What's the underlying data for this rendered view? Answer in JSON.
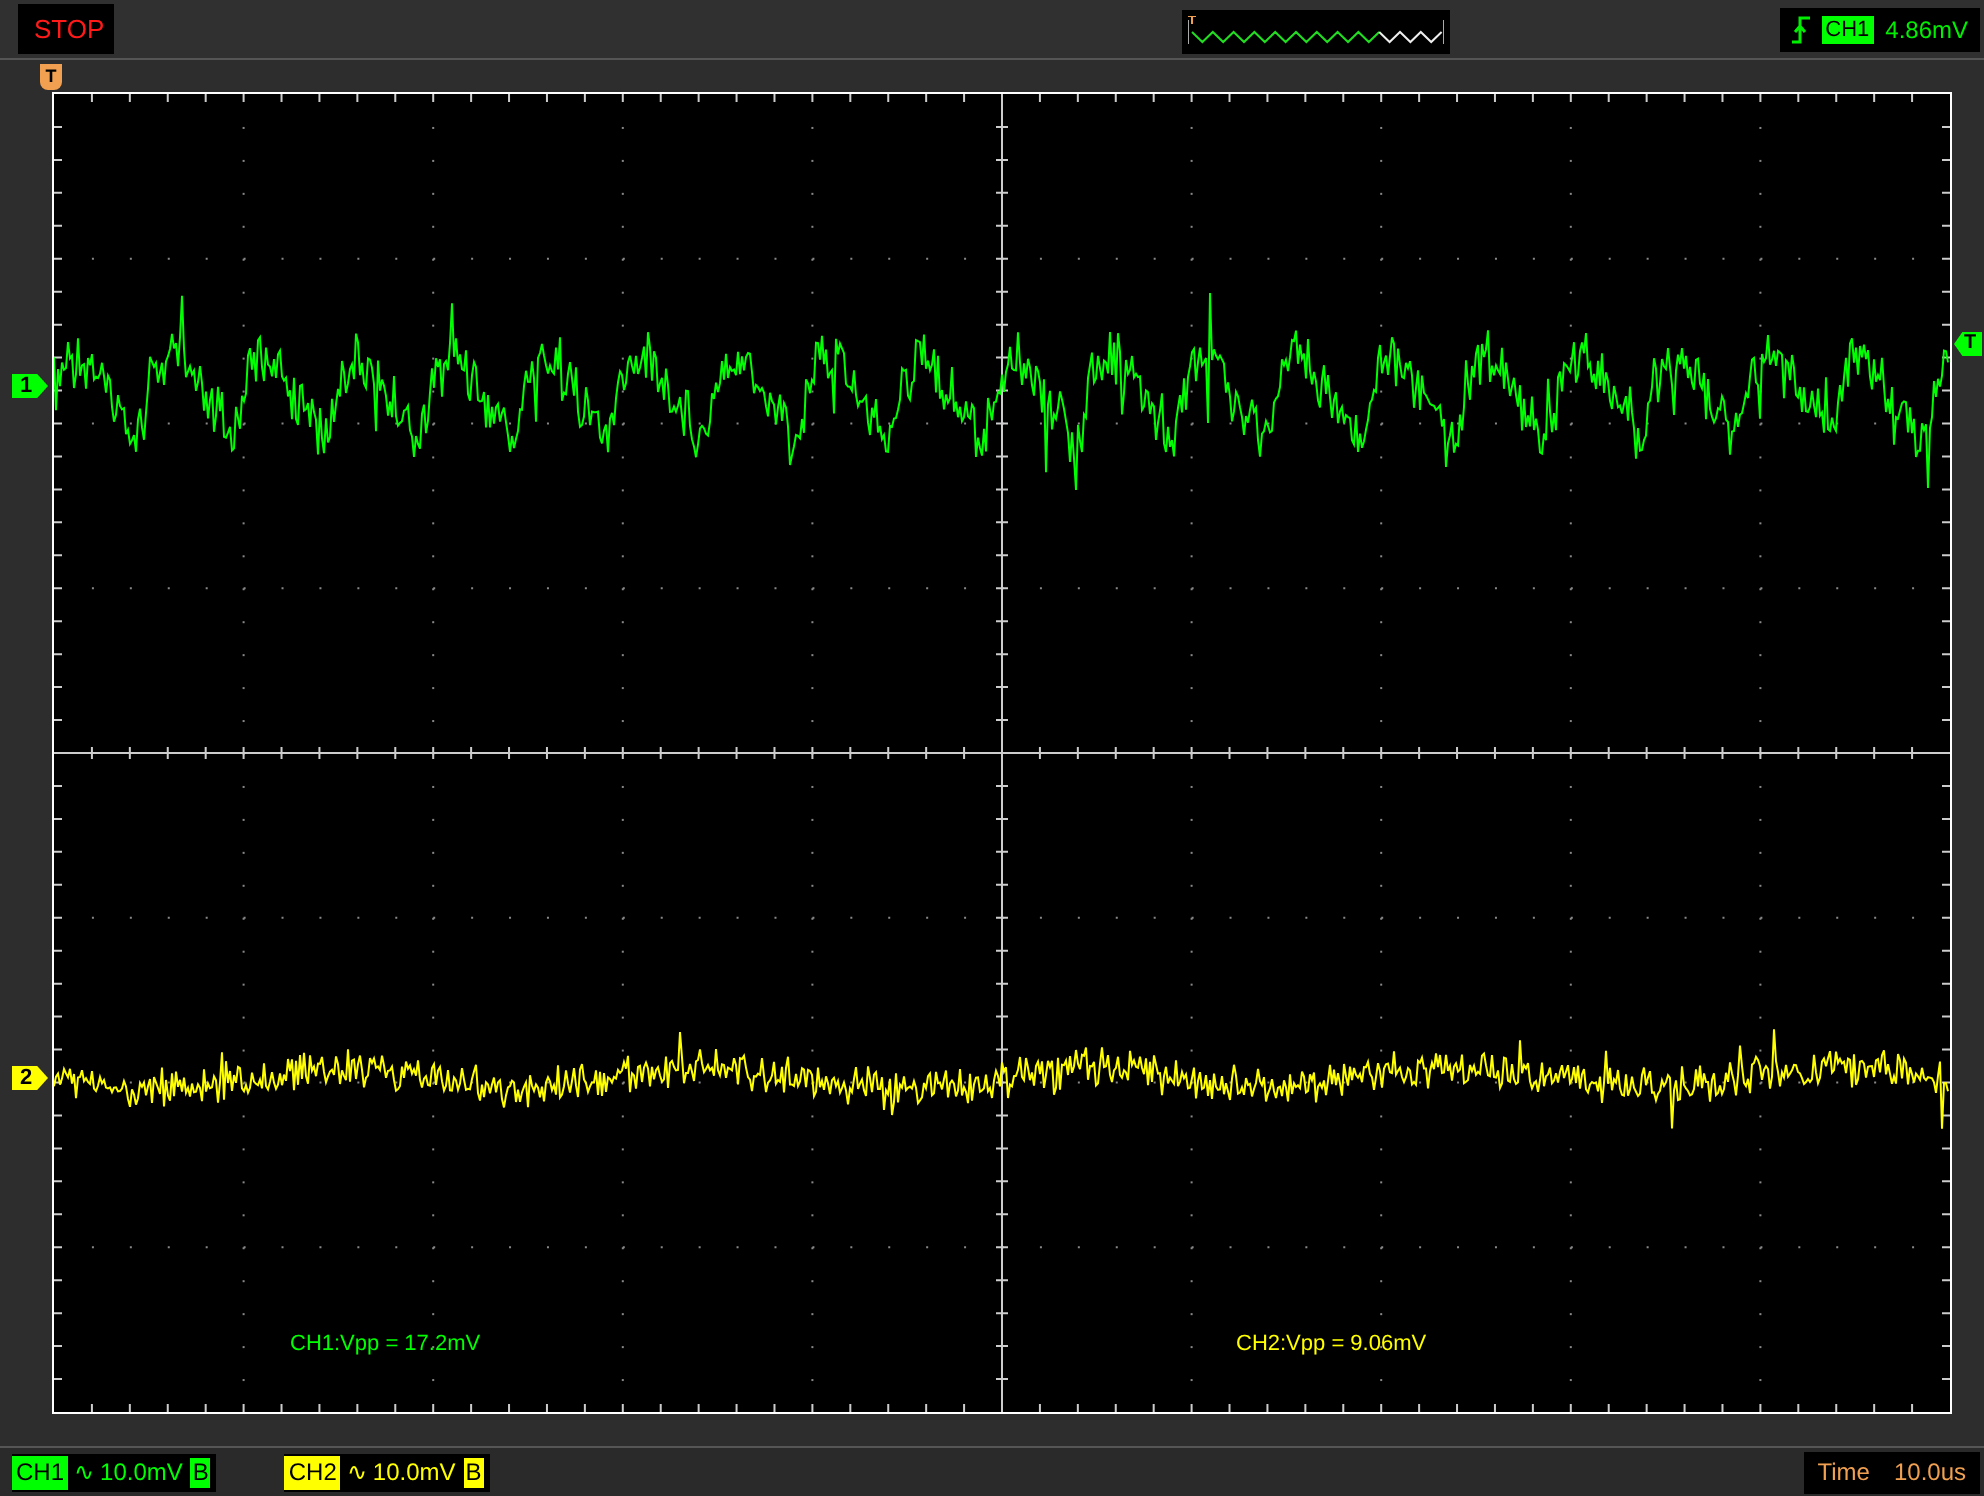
{
  "run_state": {
    "label": "STOP"
  },
  "trigger": {
    "channel": "CH1",
    "level": "4.86mV",
    "marker": "T"
  },
  "position_marker": "T",
  "channels": [
    {
      "label": "CH1",
      "coupling_symbol": "∿",
      "scale": "10.0mV",
      "bandwidth_mark": "B",
      "color": "#00ff00",
      "marker": "1",
      "measurement": "CH1:Vpp = 17.2mV"
    },
    {
      "label": "CH2",
      "coupling_symbol": "∿",
      "scale": "10.0mV",
      "bandwidth_mark": "B",
      "color": "#ffff00",
      "marker": "2",
      "measurement": "CH2:Vpp = 9.06mV"
    }
  ],
  "timebase": {
    "label": "Time",
    "value": "10.0us"
  }
}
